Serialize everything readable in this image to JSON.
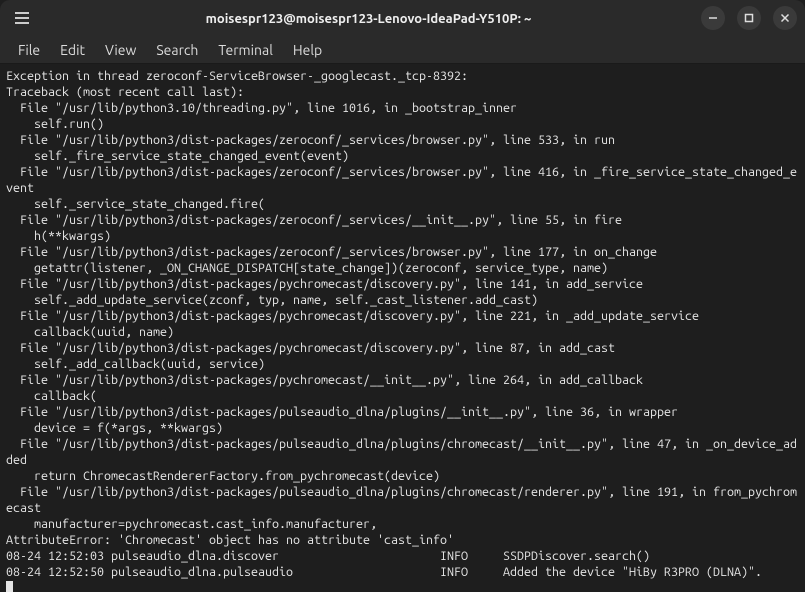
{
  "window": {
    "title": "moisespr123@moisespr123-Lenovo-IdeaPad-Y510P: ~"
  },
  "menubar": {
    "file": "File",
    "edit": "Edit",
    "view": "View",
    "search": "Search",
    "terminal": "Terminal",
    "help": "Help"
  },
  "terminal": {
    "lines": [
      "Exception in thread zeroconf-ServiceBrowser-_googlecast._tcp-8392:",
      "Traceback (most recent call last):",
      "  File \"/usr/lib/python3.10/threading.py\", line 1016, in _bootstrap_inner",
      "    self.run()",
      "  File \"/usr/lib/python3/dist-packages/zeroconf/_services/browser.py\", line 533, in run",
      "    self._fire_service_state_changed_event(event)",
      "  File \"/usr/lib/python3/dist-packages/zeroconf/_services/browser.py\", line 416, in _fire_service_state_changed_e",
      "vent",
      "    self._service_state_changed.fire(",
      "  File \"/usr/lib/python3/dist-packages/zeroconf/_services/__init__.py\", line 55, in fire",
      "    h(**kwargs)",
      "  File \"/usr/lib/python3/dist-packages/zeroconf/_services/browser.py\", line 177, in on_change",
      "    getattr(listener, _ON_CHANGE_DISPATCH[state_change])(zeroconf, service_type, name)",
      "  File \"/usr/lib/python3/dist-packages/pychromecast/discovery.py\", line 141, in add_service",
      "    self._add_update_service(zconf, typ, name, self._cast_listener.add_cast)",
      "  File \"/usr/lib/python3/dist-packages/pychromecast/discovery.py\", line 221, in _add_update_service",
      "    callback(uuid, name)",
      "  File \"/usr/lib/python3/dist-packages/pychromecast/discovery.py\", line 87, in add_cast",
      "    self._add_callback(uuid, service)",
      "  File \"/usr/lib/python3/dist-packages/pychromecast/__init__.py\", line 264, in add_callback",
      "    callback(",
      "  File \"/usr/lib/python3/dist-packages/pulseaudio_dlna/plugins/__init__.py\", line 36, in wrapper",
      "    device = f(*args, **kwargs)",
      "  File \"/usr/lib/python3/dist-packages/pulseaudio_dlna/plugins/chromecast/__init__.py\", line 47, in _on_device_ad",
      "ded",
      "    return ChromecastRendererFactory.from_pychromecast(device)",
      "  File \"/usr/lib/python3/dist-packages/pulseaudio_dlna/plugins/chromecast/renderer.py\", line 191, in from_pychrom",
      "ecast",
      "    manufacturer=pychromecast.cast_info.manufacturer,",
      "AttributeError: 'Chromecast' object has no attribute 'cast_info'",
      "08-24 12:52:03 pulseaudio_dlna.discover                       INFO     SSDPDiscover.search()",
      "08-24 12:52:50 pulseaudio_dlna.pulseaudio                     INFO     Added the device \"HiBy R3PRO (DLNA)\"."
    ]
  }
}
